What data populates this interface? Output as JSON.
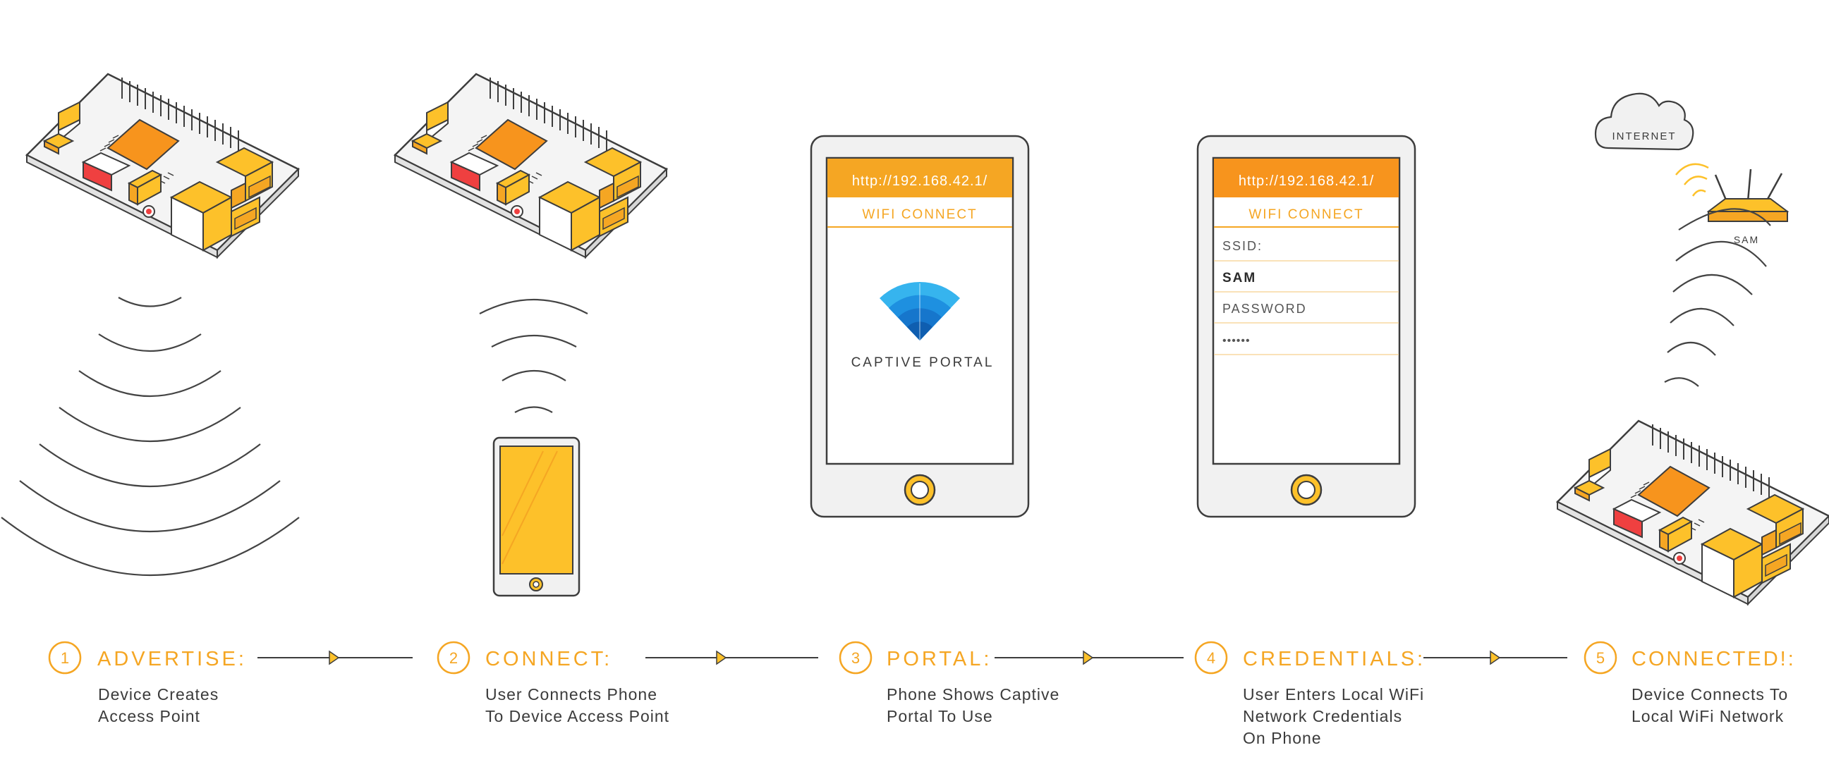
{
  "colors": {
    "orange": "#f5a623",
    "yellow": "#fdc12a",
    "dark_orange": "#f7941d",
    "red": "#ef4040",
    "stroke": "#3d3d3d",
    "wave": "#444444",
    "phone_body": "#f1f1f1",
    "text": "#3b3b3b",
    "blue": "#2a9be0"
  },
  "phone3": {
    "url": "http://192.168.42.1/",
    "header": "WIFI CONNECT",
    "portal_label": "CAPTIVE PORTAL"
  },
  "phone4": {
    "url": "http://192.168.42.1/",
    "header": "WIFI CONNECT",
    "ssid_label": "SSID:",
    "ssid_value": "SAM",
    "password_label": "PASSWORD",
    "password_value": "••••••"
  },
  "cloud_label": "INTERNET",
  "router_label": "SAM",
  "steps": [
    {
      "number": "1",
      "title": "ADVERTISE:",
      "desc": [
        "Device Creates",
        "Access Point"
      ]
    },
    {
      "number": "2",
      "title": "CONNECT:",
      "desc": [
        "User Connects Phone",
        "To Device Access Point"
      ]
    },
    {
      "number": "3",
      "title": "PORTAL:",
      "desc": [
        "Phone Shows Captive",
        "Portal To Use"
      ]
    },
    {
      "number": "4",
      "title": "CREDENTIALS:",
      "desc": [
        "User Enters Local WiFi",
        "Network Credentials",
        "On Phone"
      ]
    },
    {
      "number": "5",
      "title": "CONNECTED!:",
      "desc": [
        "Device Connects To",
        "Local WiFi Network"
      ]
    }
  ],
  "icons": [
    "device-board-icon",
    "wifi-waves-icon",
    "smartphone-icon",
    "wifi-logo-icon",
    "cloud-icon",
    "router-icon",
    "arrow-icon"
  ]
}
